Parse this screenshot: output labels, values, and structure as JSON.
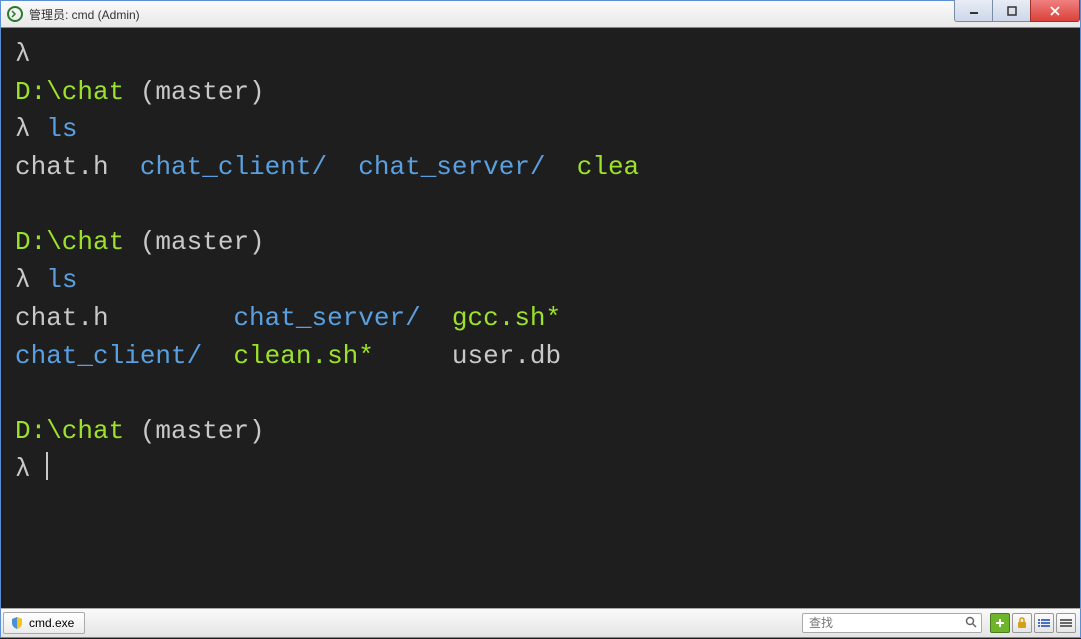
{
  "titlebar": {
    "title": "管理员: cmd (Admin)"
  },
  "prompts": {
    "lambda": "λ",
    "path": "D:\\chat",
    "branch": "(master)"
  },
  "commands": {
    "ls": "ls"
  },
  "listing1": {
    "item1": "chat.h",
    "item2": "chat_client/",
    "item3": "chat_server/",
    "item4": "clea"
  },
  "listing2": {
    "row1": {
      "c1": "chat.h",
      "c2": "chat_server/",
      "c3": "gcc.sh*"
    },
    "row2": {
      "c1": "chat_client/",
      "c2": "clean.sh*",
      "c3": "user.db"
    }
  },
  "statusbar": {
    "tab_label": "cmd.exe",
    "search_placeholder": "查找"
  }
}
